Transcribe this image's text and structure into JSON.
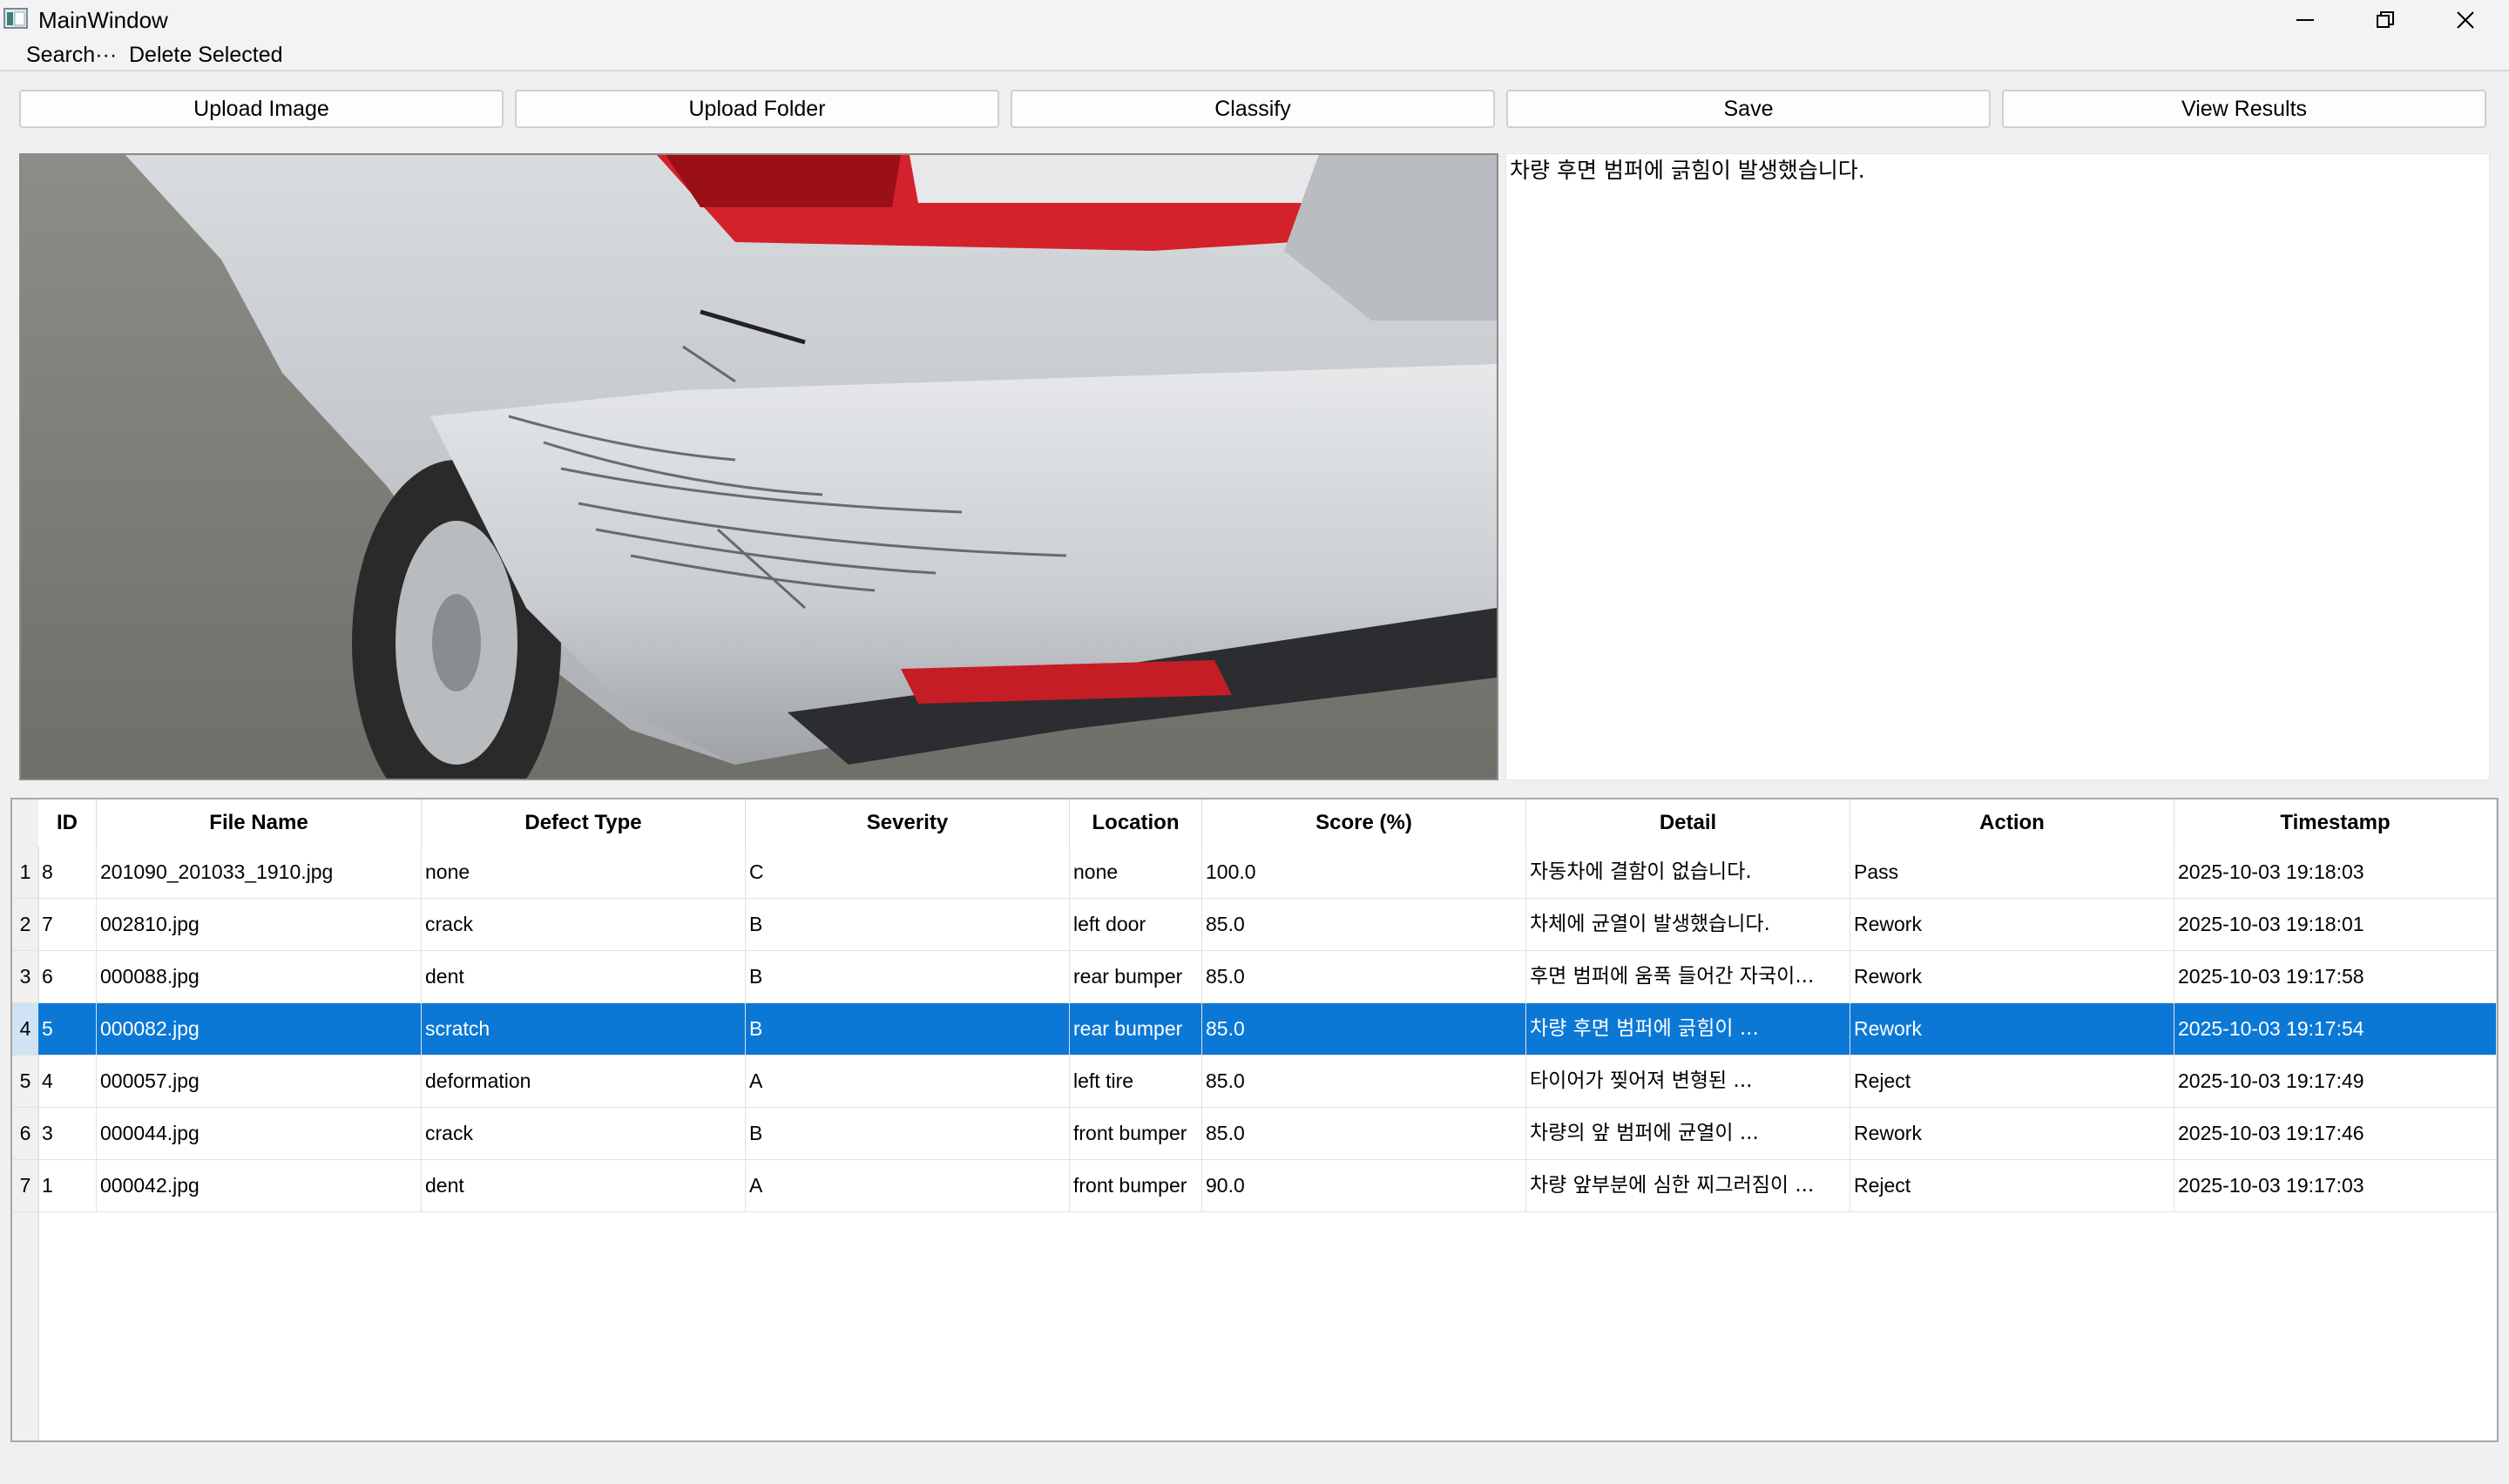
{
  "window": {
    "title": "MainWindow",
    "icon": "app-window-icon",
    "controls": [
      "minimize-icon",
      "restore-icon",
      "close-icon"
    ]
  },
  "menu": {
    "search": "Search···",
    "delete_selected": "Delete Selected"
  },
  "toolbar": {
    "upload_image": "Upload Image",
    "upload_folder": "Upload Folder",
    "classify": "Classify",
    "save": "Save",
    "view_results": "View Results"
  },
  "description": {
    "text": "차량 후면 범퍼에 긁힘이 발생했습니다."
  },
  "table": {
    "headers": {
      "id": "ID",
      "file_name": "File Name",
      "defect_type": "Defect Type",
      "severity": "Severity",
      "location": "Location",
      "score": "Score (%)",
      "detail": "Detail",
      "action": "Action",
      "timestamp": "Timestamp"
    },
    "selected_row": 4,
    "rows": [
      {
        "n": "1",
        "id": "8",
        "file": "201090_201033_1910.jpg",
        "type": "none",
        "severity": "C",
        "location": "none",
        "score": "100.0",
        "detail": "자동차에 결함이 없습니다.",
        "action": "Pass",
        "timestamp": "2025-10-03 19:18:03"
      },
      {
        "n": "2",
        "id": "7",
        "file": "002810.jpg",
        "type": "crack",
        "severity": "B",
        "location": "left door",
        "score": "85.0",
        "detail": "차체에 균열이 발생했습니다.",
        "action": "Rework",
        "timestamp": "2025-10-03 19:18:01"
      },
      {
        "n": "3",
        "id": "6",
        "file": "000088.jpg",
        "type": "dent",
        "severity": "B",
        "location": "rear bumper",
        "score": "85.0",
        "detail": "후면 범퍼에 움푹 들어간 자국이...",
        "action": "Rework",
        "timestamp": "2025-10-03 19:17:58"
      },
      {
        "n": "4",
        "id": "5",
        "file": "000082.jpg",
        "type": "scratch",
        "severity": "B",
        "location": "rear bumper",
        "score": "85.0",
        "detail": "차량 후면 범퍼에 긁힘이 ...",
        "action": "Rework",
        "timestamp": "2025-10-03 19:17:54"
      },
      {
        "n": "5",
        "id": "4",
        "file": "000057.jpg",
        "type": "deformation",
        "severity": "A",
        "location": "left tire",
        "score": "85.0",
        "detail": "타이어가 찢어져 변형된 ...",
        "action": "Reject",
        "timestamp": "2025-10-03 19:17:49"
      },
      {
        "n": "6",
        "id": "3",
        "file": "000044.jpg",
        "type": "crack",
        "severity": "B",
        "location": "front bumper",
        "score": "85.0",
        "detail": "차량의 앞 범퍼에 균열이 ...",
        "action": "Rework",
        "timestamp": "2025-10-03 19:17:46"
      },
      {
        "n": "7",
        "id": "1",
        "file": "000042.jpg",
        "type": "dent",
        "severity": "A",
        "location": "front bumper",
        "score": "90.0",
        "detail": "차량 앞부분에 심한 찌그러짐이 ...",
        "action": "Reject",
        "timestamp": "2025-10-03 19:17:03"
      }
    ]
  },
  "colors": {
    "selection": "#0b78d6",
    "window_bg": "#f0f0f0"
  }
}
